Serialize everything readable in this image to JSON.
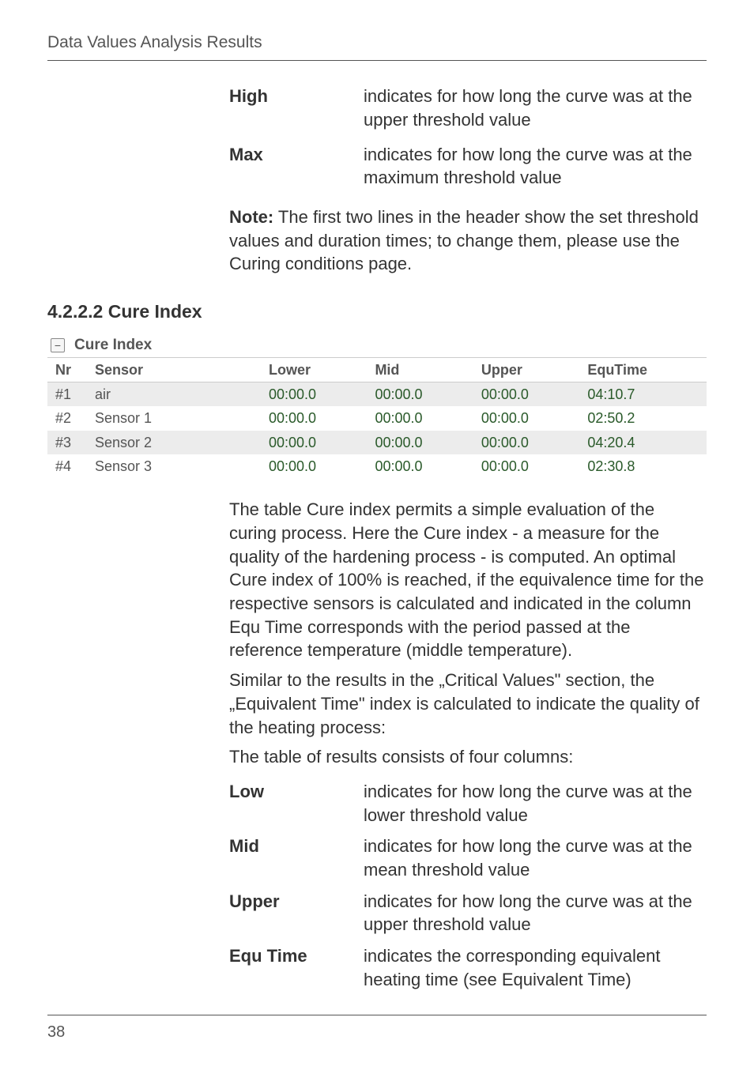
{
  "page": {
    "header": "Data Values Analysis Results",
    "number": "38"
  },
  "top_defs": [
    {
      "term": "High",
      "desc": "indicates for how long the curve was at the upper threshold value"
    },
    {
      "term": "Max",
      "desc": "indicates for how long the curve was at the maximum threshold value"
    }
  ],
  "note": {
    "label": "Note:",
    "text": " The first two lines in the header show the set threshold values and duration times; to change them, please use the Curing conditions page."
  },
  "section": {
    "heading": "4.2.2.2 Cure Index",
    "cure_title": "Cure Index",
    "toggle_glyph": "−"
  },
  "table": {
    "headers": {
      "nr": "Nr",
      "sensor": "Sensor",
      "lower": "Lower",
      "mid": "Mid",
      "upper": "Upper",
      "equ": "EquTime"
    },
    "rows": [
      {
        "nr": "#1",
        "sensor": "air",
        "lower": "00:00.0",
        "mid": "00:00.0",
        "upper": "00:00.0",
        "equ": "04:10.7"
      },
      {
        "nr": "#2",
        "sensor": "Sensor 1",
        "lower": "00:00.0",
        "mid": "00:00.0",
        "upper": "00:00.0",
        "equ": "02:50.2"
      },
      {
        "nr": "#3",
        "sensor": "Sensor 2",
        "lower": "00:00.0",
        "mid": "00:00.0",
        "upper": "00:00.0",
        "equ": "04:20.4"
      },
      {
        "nr": "#4",
        "sensor": "Sensor 3",
        "lower": "00:00.0",
        "mid": "00:00.0",
        "upper": "00:00.0",
        "equ": "02:30.8"
      }
    ]
  },
  "body": {
    "p1": "The table Cure index permits a simple evaluation of the curing process. Here the Cure index - a measure for the quality of the hardening process - is computed. An optimal Cure index of 100% is reached, if the equivalence time for the respective sensors is calculated and indicated in the column Equ Time corresponds with the period passed at the reference temperature (middle temperature).",
    "p2": "Similar to the results in the „Critical Values\" section, the „Equivalent Time\" index is calculated to indicate the quality of the heating process:",
    "p3": "The table of results consists of four columns:"
  },
  "col_defs": [
    {
      "term": "Low",
      "desc": "indicates for how long the curve was at the lower threshold value"
    },
    {
      "term": "Mid",
      "desc": "indicates for how long the curve was at the mean threshold value"
    },
    {
      "term": "Upper",
      "desc": "indicates for how long the curve was at the upper threshold value"
    },
    {
      "term": "Equ Time",
      "desc": "indicates the corresponding equivalent heating time (see Equivalent Time)"
    }
  ]
}
